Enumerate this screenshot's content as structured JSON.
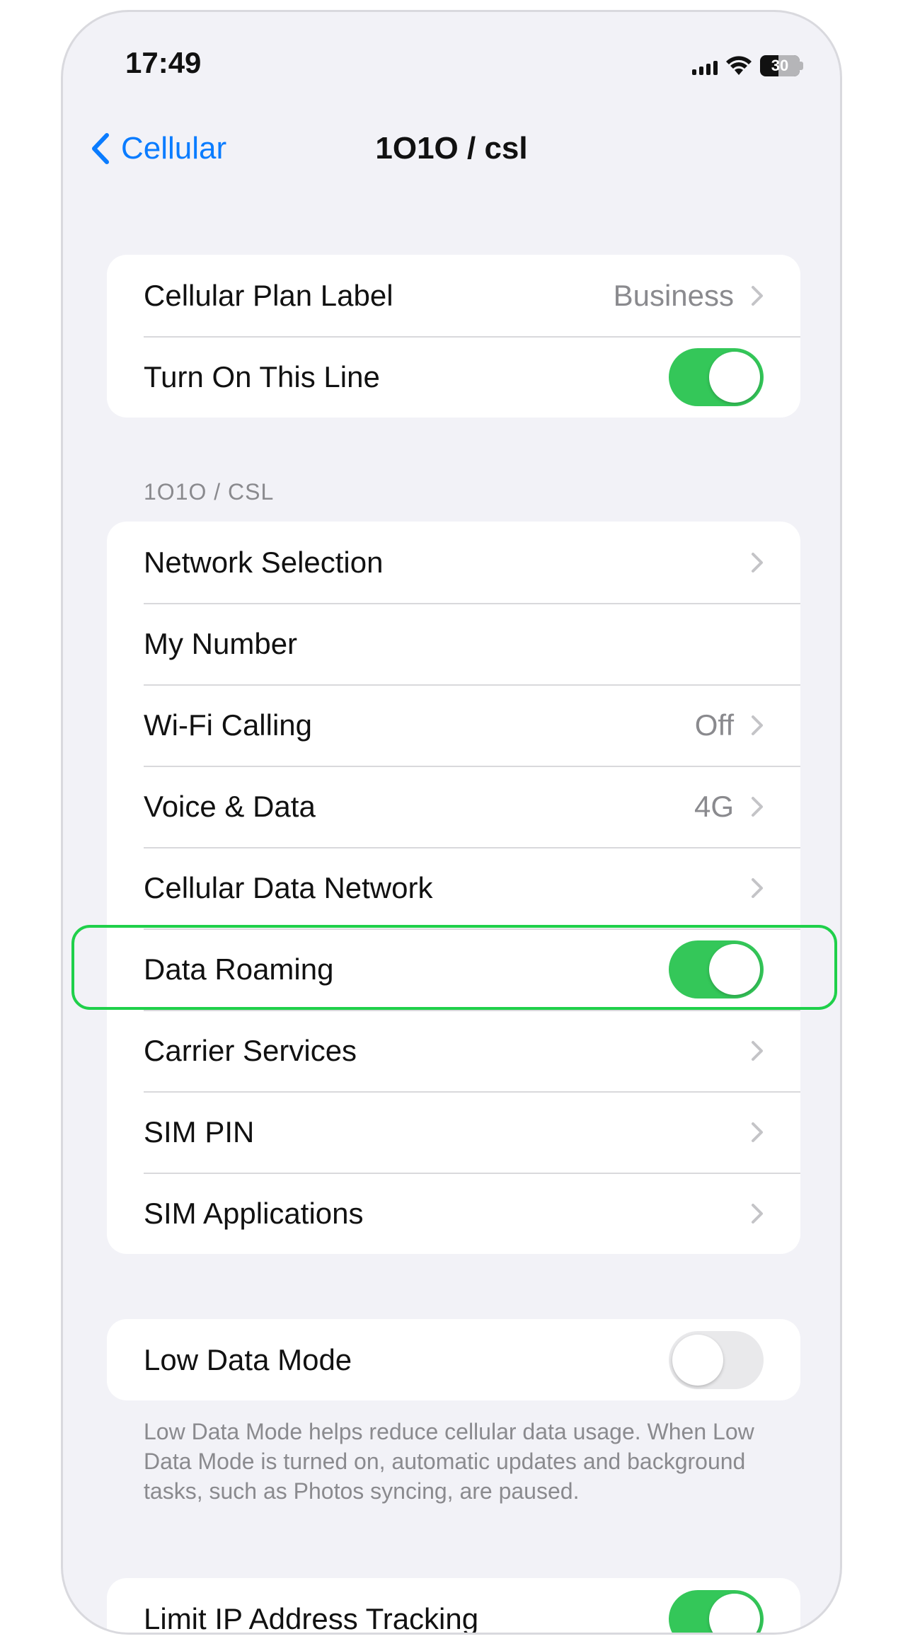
{
  "status_bar": {
    "time": "17:49",
    "battery": "30"
  },
  "nav": {
    "back_label": "Cellular",
    "title": "1O1O / csl"
  },
  "group1": {
    "plan_label": {
      "label": "Cellular Plan Label",
      "value": "Business"
    },
    "turn_on_line": {
      "label": "Turn On This Line",
      "state": "on"
    }
  },
  "section_header": "1O1O / CSL",
  "group2": {
    "rows": [
      {
        "label": "Network Selection",
        "value": ""
      },
      {
        "label": "My Number",
        "value": ""
      },
      {
        "label": "Wi-Fi Calling",
        "value": "Off"
      },
      {
        "label": "Voice & Data",
        "value": "4G"
      },
      {
        "label": "Cellular Data Network",
        "value": ""
      },
      {
        "label": "Data Roaming",
        "state": "on"
      },
      {
        "label": "Carrier Services",
        "value": ""
      },
      {
        "label": "SIM PIN",
        "value": ""
      },
      {
        "label": "SIM Applications",
        "value": ""
      }
    ]
  },
  "group3": {
    "low_data_mode": {
      "label": "Low Data Mode",
      "state": "off"
    },
    "footer": "Low Data Mode helps reduce cellular data usage. When Low Data Mode is turned on, automatic updates and background tasks, such as Photos syncing, are paused."
  },
  "group4": {
    "limit_ip": {
      "label": "Limit IP Address Tracking",
      "state": "on"
    }
  },
  "colors": {
    "accent": "#0a7cff",
    "toggle_on": "#34c759",
    "highlight": "#1fd04a",
    "background": "#f2f2f7"
  }
}
